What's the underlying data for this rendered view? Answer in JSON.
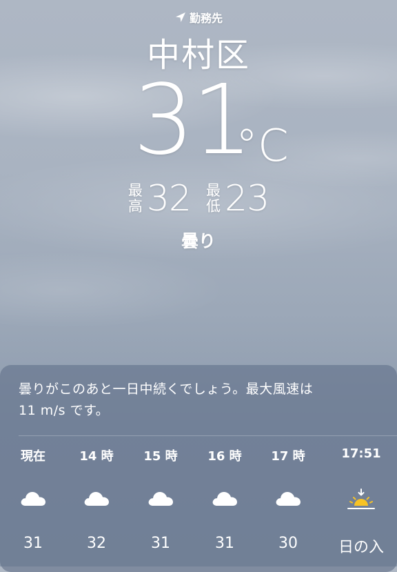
{
  "header": {
    "location_label": "勤務先",
    "location_icon": "location-arrow-icon",
    "city": "中村区",
    "temperature": "31",
    "unit": "°C",
    "high_label_top": "最",
    "high_label_bottom": "高",
    "high": "32",
    "low_label_top": "最",
    "low_label_bottom": "低",
    "low": "23",
    "condition": "曇り"
  },
  "forecast": {
    "summary_line1": "曇りがこのあと一日中続くでしょう。最大風速は",
    "summary_line2": "11 m/s です。",
    "hours": [
      {
        "label": "現在",
        "icon": "cloud-icon",
        "value": "31"
      },
      {
        "label": "14 時",
        "icon": "cloud-icon",
        "value": "32"
      },
      {
        "label": "15 時",
        "icon": "cloud-icon",
        "value": "31"
      },
      {
        "label": "16 時",
        "icon": "cloud-icon",
        "value": "31"
      },
      {
        "label": "17 時",
        "icon": "cloud-icon",
        "value": "30"
      },
      {
        "label": "17:51",
        "icon": "sunset-icon",
        "value": "日の入"
      }
    ]
  },
  "colors": {
    "sun": "#f7c325",
    "text": "#ffffff"
  }
}
